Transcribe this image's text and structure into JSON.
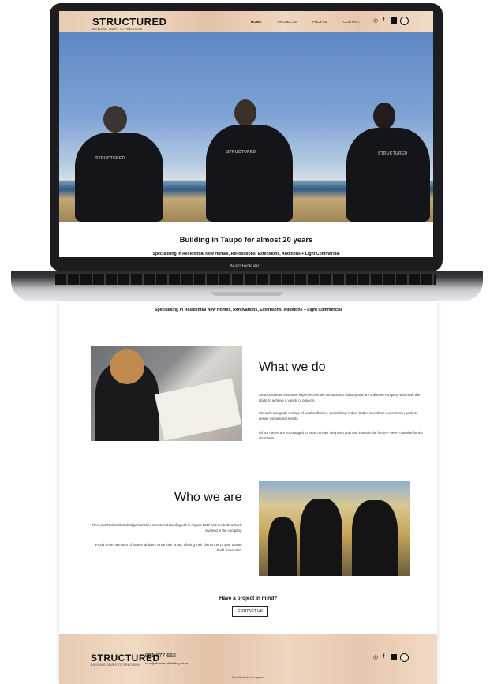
{
  "laptop": {
    "model_label": "MacBook Air"
  },
  "site": {
    "logo": "STRUCTURED",
    "logo_tagline": "BUILDING TAUPO TO PRECISION",
    "nav": [
      "HOME",
      "PROJECTS",
      "PROFILE",
      "CONTACT"
    ],
    "nav_icons": [
      "instagram-icon",
      "facebook-icon",
      "nzcb-icon",
      "master-builders-icon"
    ]
  },
  "hero": {
    "title": "Building in Taupo for almost 20 years",
    "subtitle": "Specialising in Residential New Homes, Renovations, Extensions, Additions + Light Commercial",
    "shirt_logo": "STRUCTURED"
  },
  "what_we_do": {
    "heading": "What we do",
    "paragraphs": [
      "Structured have extensive experience in the construction industry and are a diverse company who have the ability to achieve a variety of projects.",
      "We work alongside a range of local craftsmen, specialising in their trades who share our common goal; to deliver exceptional results.",
      "All our clients are encouraged to focus on their long term goal and invest in the future – never optimise for the short term."
    ]
  },
  "who_we_are": {
    "heading": "Who we are",
    "paragraphs": [
      "Trent and Rachel Strawbridge launched Structured Building Ltd in August 2017 and are both actively involved in the company.",
      "Proud to be members of Master Builders since their onset, offering their clients the 10 year Master Build Guarantee."
    ]
  },
  "cta": {
    "question": "Have a project in mind?",
    "button": "CONTACT US"
  },
  "footer": {
    "logo": "STRUCTURED",
    "logo_tagline": "BUILDING TAUPO TO PRECISION",
    "phone": "021 877 662",
    "email": "trent@structuredbuilding.co.nz",
    "credit": "Proudly made by Legend."
  }
}
